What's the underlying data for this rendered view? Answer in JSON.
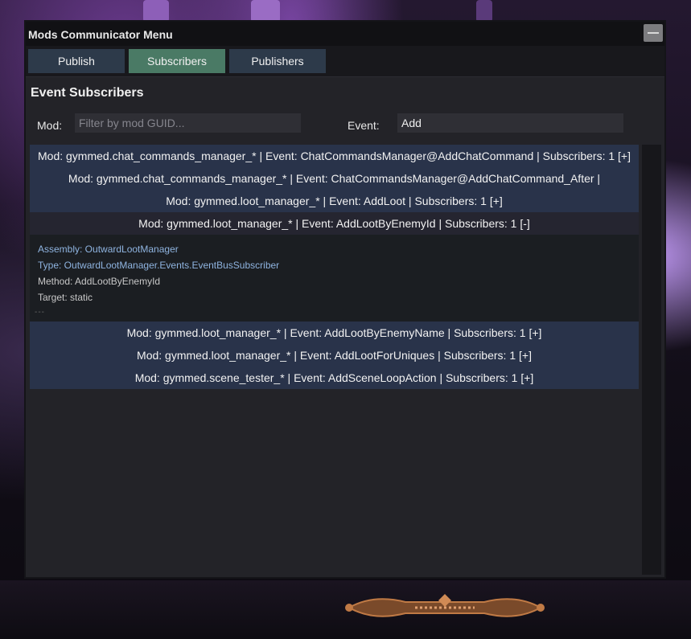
{
  "window": {
    "title": "Mods Communicator Menu"
  },
  "tabs": [
    {
      "label": "Publish",
      "active": false
    },
    {
      "label": "Subscribers",
      "active": true
    },
    {
      "label": "Publishers",
      "active": false
    }
  ],
  "section_title": "Event Subscribers",
  "filters": {
    "mod_label": "Mod:",
    "mod_placeholder": "Filter by mod GUID...",
    "mod_value": "",
    "event_label": "Event:",
    "event_value": "Add"
  },
  "rows": [
    {
      "text": "Mod: gymmed.chat_commands_manager_* | Event: ChatCommandsManager@AddChatCommand | Subscribers: 1 [+]"
    },
    {
      "text": "Mod: gymmed.chat_commands_manager_* | Event: ChatCommandsManager@AddChatCommand_After |"
    },
    {
      "text": "Mod: gymmed.loot_manager_* | Event: AddLoot | Subscribers: 1 [+]"
    },
    {
      "text": "Mod: gymmed.loot_manager_* | Event: AddLootByEnemyId | Subscribers: 1 [-]"
    },
    {
      "text": "Mod: gymmed.loot_manager_* | Event: AddLootByEnemyName | Subscribers: 1 [+]"
    },
    {
      "text": "Mod: gymmed.loot_manager_* | Event: AddLootForUniques | Subscribers: 1 [+]"
    },
    {
      "text": "Mod: gymmed.scene_tester_* | Event: AddSceneLoopAction | Subscribers: 1 [+]"
    }
  ],
  "expanded_details": {
    "assembly": "Assembly: OutwardLootManager",
    "type": "Type: OutwardLootManager.Events.EventBusSubscriber",
    "method": "Method: AddLootByEnemyId",
    "target": "Target: static",
    "separator": "---"
  },
  "colors": {
    "tab_active": "#4a7a65",
    "tab_inactive": "#2d3a4a",
    "row_bg": "#29334a",
    "details_blue": "#8fb4e0"
  }
}
